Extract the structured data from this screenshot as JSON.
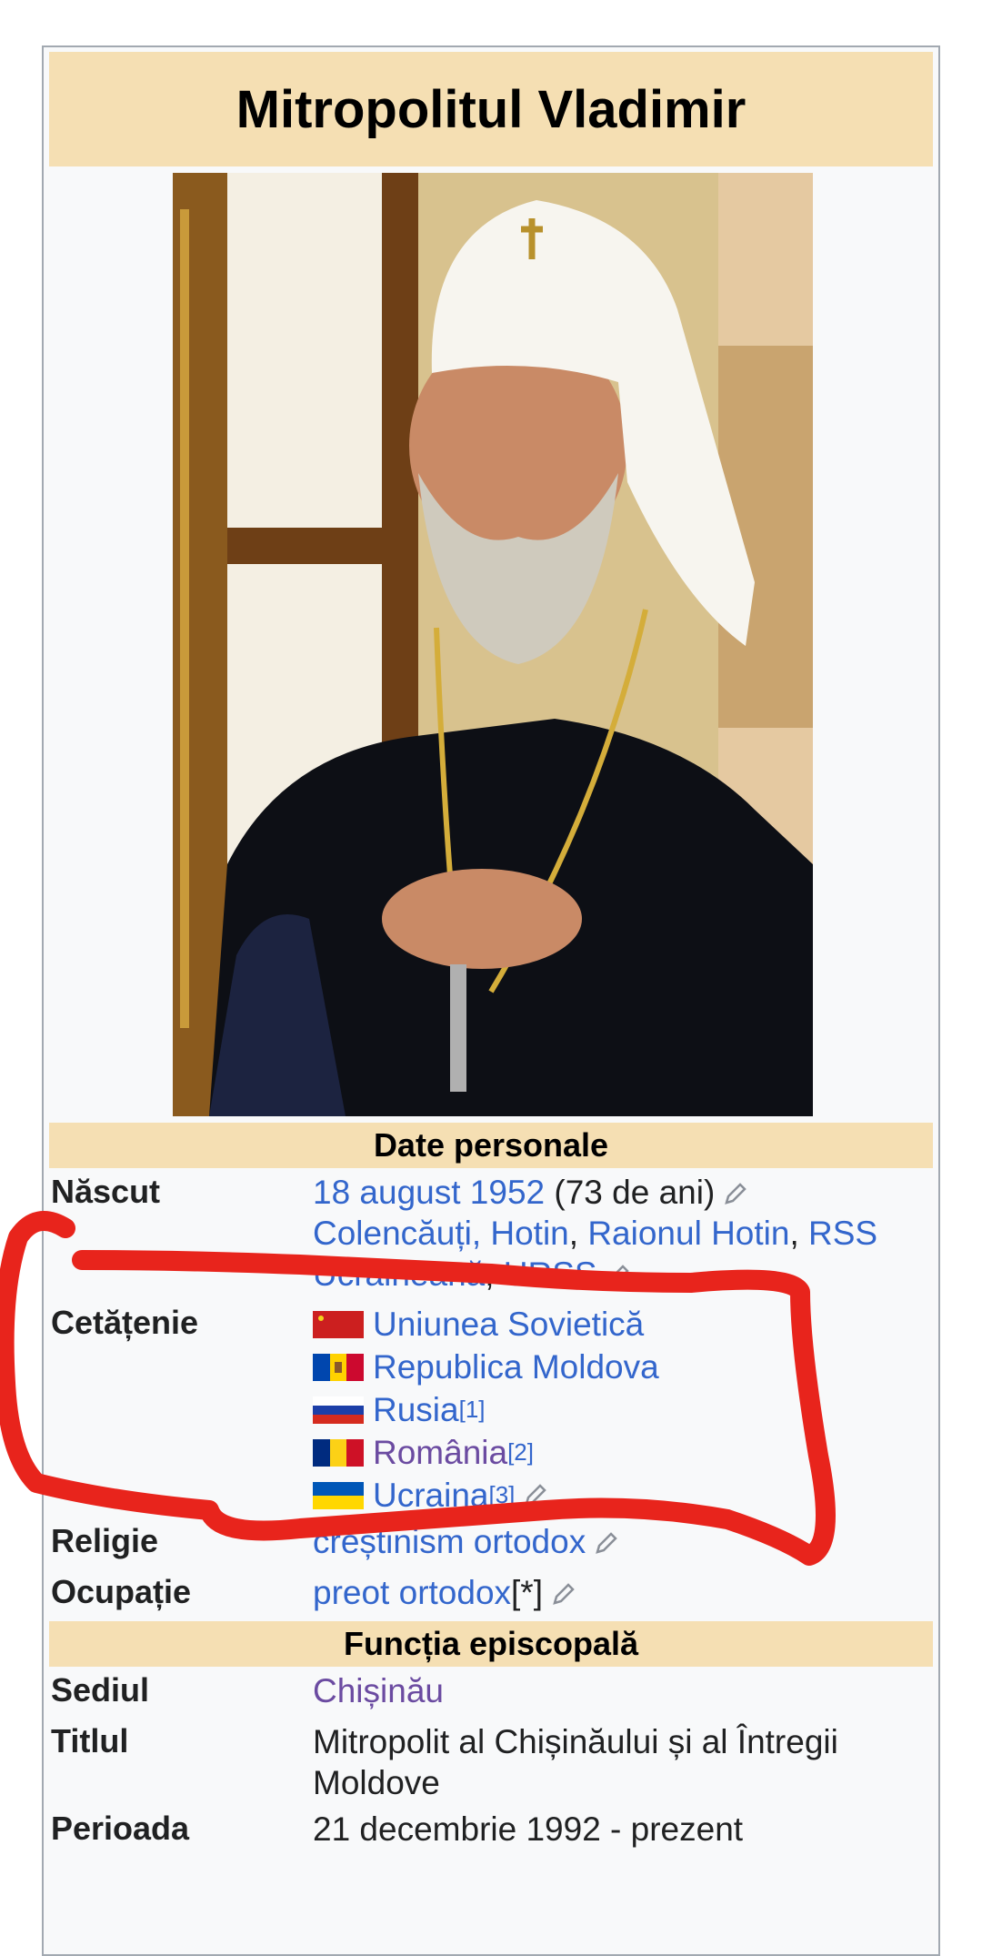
{
  "infobox": {
    "title": "Mitropolitul Vladimir",
    "section_personal": "Date personale",
    "section_episcopal": "Funcția episcopală"
  },
  "born": {
    "label": "Născut",
    "date_link": "18 august 1952",
    "age": " (73 de ani)",
    "place_1": "Colencăuți, Hotin",
    "sep": ", ",
    "place_2": "Raionul Hotin",
    "place_3": "RSS Ucraineană",
    "place_4": "URSS"
  },
  "citizenship": {
    "label": "Cetățenie",
    "items": [
      {
        "name": "Uniunea Sovietică",
        "ref": "",
        "flag": "ussr-flag-icon"
      },
      {
        "name": "Republica Moldova",
        "ref": "",
        "flag": "moldova-flag-icon"
      },
      {
        "name": "Rusia",
        "ref": "[1]",
        "flag": "russia-flag-icon"
      },
      {
        "name": "România",
        "ref": "[2]",
        "flag": "romania-flag-icon"
      },
      {
        "name": "Ucraina",
        "ref": "[3]",
        "flag": "ukraine-flag-icon"
      }
    ]
  },
  "religion": {
    "label": "Religie",
    "value": "creștinism ortodox"
  },
  "occupation": {
    "label": "Ocupație",
    "value": "preot ortodox",
    "note": "[*]"
  },
  "seat": {
    "label": "Sediul",
    "value": "Chișinău"
  },
  "titlul": {
    "label": "Titlul",
    "value": "Mitropolit al Chișinăului și al Întregii Moldove"
  },
  "period": {
    "label": "Perioada",
    "value": "21 decembrie 1992 - prezent"
  },
  "colors": {
    "header_bg": "#f5dfb3",
    "link": "#3366cc",
    "visited_link": "#6b4ba1",
    "annotation": "#e8241c"
  }
}
